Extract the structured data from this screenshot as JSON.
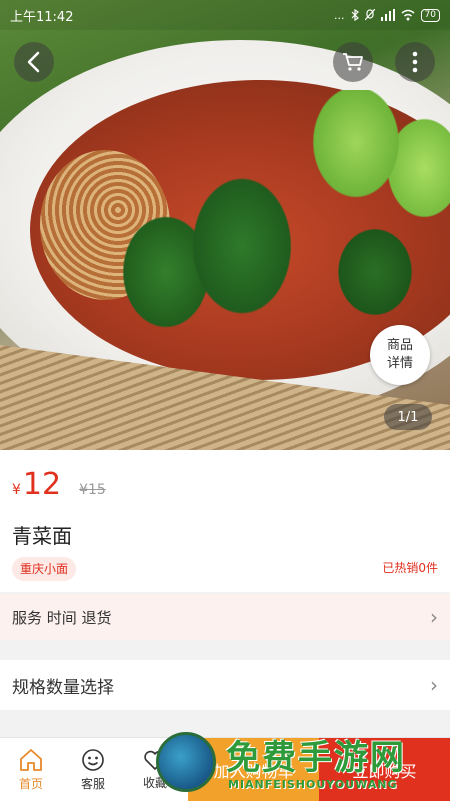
{
  "status_bar": {
    "time": "上午11:42",
    "signal": "...",
    "battery": "70"
  },
  "hero": {
    "pager": "1/1",
    "details_label_line1": "商品",
    "details_label_line2": "详情"
  },
  "product": {
    "price_symbol": "¥",
    "price": "12",
    "original_price": "¥15",
    "name": "青菜面",
    "tag": "重庆小面",
    "sold": "已热销0件"
  },
  "service": {
    "label": "服务 时间 退货"
  },
  "spec": {
    "label": "规格数量选择"
  },
  "bottom_nav": {
    "items": [
      {
        "label": "首页",
        "icon": "home-icon"
      },
      {
        "label": "客服",
        "icon": "smiley-icon"
      },
      {
        "label": "收藏",
        "icon": "heart-icon"
      }
    ],
    "add_to_cart": "加入购物车",
    "buy_now": "立即购买"
  },
  "watermark": {
    "title": "免费手游网",
    "subtitle": "MIANFEISHOUYOUWANG"
  },
  "colors": {
    "accent": "#e0301e",
    "orange": "#f2a12a",
    "active_nav": "#e8892c"
  }
}
